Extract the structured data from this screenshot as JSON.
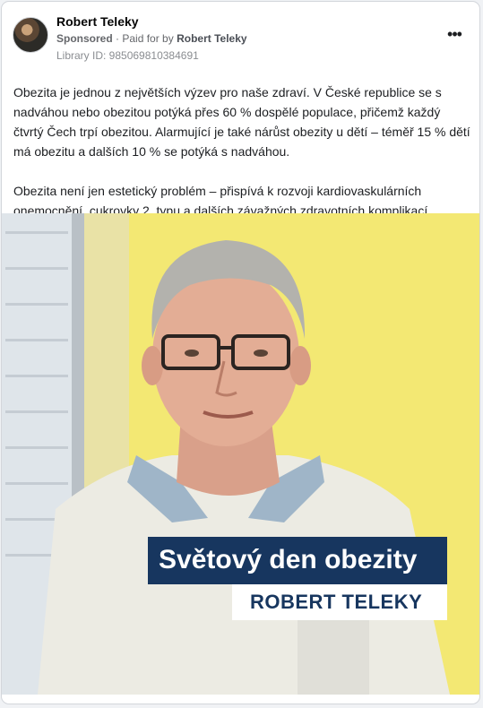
{
  "post": {
    "author": "Robert Teleky",
    "sponsored_label": "Sponsored",
    "paid_for_prefix": "Paid for by",
    "payer": "Robert Teleky",
    "library_id": "Library ID: 985069810384691",
    "paragraphs": [
      "Obezita je jednou z největších výzev pro naše zdraví. V České republice se s nadváhou nebo obezitou potýká přes 60 % dospělé populace, přičemž každý čtvrtý Čech trpí obezitou. Alarmující je také nárůst obezity u dětí – téměř 15 % dětí má obezitu a dalších 10 % se potýká s nadváhou.",
      "Obezita není jen estetický problém – přispívá k rozvoji kardiovaskulárních onemocnění, cukrovky 2. typu a dalších závažných zdravotních komplikací...."
    ]
  },
  "image": {
    "title": "Světový den obezity",
    "subtitle": "ROBERT TELEKY"
  },
  "icons": {
    "more": "more-options-icon",
    "avatar": "profile-avatar"
  },
  "colors": {
    "banner_navy": "#17365f",
    "background_yellow": "#f3e873"
  }
}
